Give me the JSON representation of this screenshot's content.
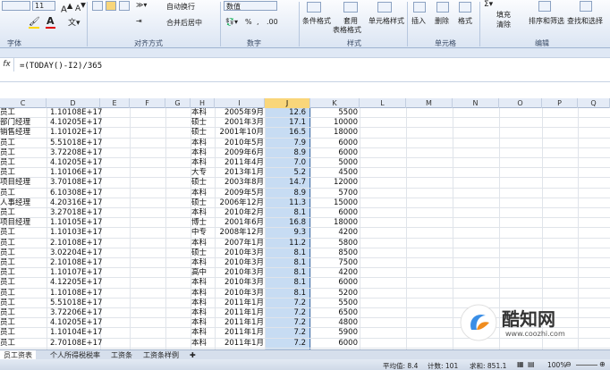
{
  "ribbon": {
    "font_size": "11",
    "wrap_text": "自动换行",
    "merge_center": "合并后居中",
    "number_format": "数值",
    "conditional_format": "条件格式",
    "table_format_1": "套用",
    "table_format_2": "表格格式",
    "cell_style": "单元格样式",
    "insert": "插入",
    "delete": "删除",
    "format": "格式",
    "fill": "填充",
    "clear": "清除",
    "sort_filter": "排序和筛选",
    "find_select": "查找和选择",
    "groups": [
      "字体",
      "对齐方式",
      "数字",
      "样式",
      "单元格",
      "编辑"
    ]
  },
  "formula_bar": {
    "fx": "fx",
    "formula": "=(TODAY()-I2)/365"
  },
  "columns": [
    "C",
    "D",
    "E",
    "F",
    "G",
    "H",
    "I",
    "J",
    "K",
    "L",
    "M",
    "N",
    "O",
    "P",
    "Q"
  ],
  "rows": [
    [
      "员工",
      "1.10108E+17",
      "本科",
      "2005年9月",
      "12.6",
      "5500"
    ],
    [
      "部门经理",
      "4.10205E+17",
      "硕士",
      "2001年3月",
      "17.1",
      "10000"
    ],
    [
      "销售经理",
      "1.10102E+17",
      "硕士",
      "2001年10月",
      "16.5",
      "18000"
    ],
    [
      "员工",
      "5.51018E+17",
      "本科",
      "2010年5月",
      "7.9",
      "6000"
    ],
    [
      "员工",
      "3.72208E+17",
      "本科",
      "2009年6月",
      "8.9",
      "6000"
    ],
    [
      "员工",
      "4.10205E+17",
      "本科",
      "2011年4月",
      "7.0",
      "5000"
    ],
    [
      "员工",
      "1.10106E+17",
      "大专",
      "2013年1月",
      "5.2",
      "4500"
    ],
    [
      "项目经理",
      "3.70108E+17",
      "硕士",
      "2003年8月",
      "14.7",
      "12000"
    ],
    [
      "员工",
      "6.10308E+17",
      "本科",
      "2009年5月",
      "8.9",
      "5700"
    ],
    [
      "人事经理",
      "4.20316E+17",
      "硕士",
      "2006年12月",
      "11.3",
      "15000"
    ],
    [
      "员工",
      "3.27018E+17",
      "本科",
      "2010年2月",
      "8.1",
      "6000"
    ],
    [
      "项目经理",
      "1.10105E+17",
      "博士",
      "2001年6月",
      "16.8",
      "18000"
    ],
    [
      "员工",
      "1.10103E+17",
      "中专",
      "2008年12月",
      "9.3",
      "4200"
    ],
    [
      "员工",
      "2.10108E+17",
      "本科",
      "2007年1月",
      "11.2",
      "5800"
    ],
    [
      "员工",
      "3.02204E+17",
      "硕士",
      "2010年3月",
      "8.1",
      "8500"
    ],
    [
      "员工",
      "2.10108E+17",
      "本科",
      "2010年3月",
      "8.1",
      "7500"
    ],
    [
      "员工",
      "1.10107E+17",
      "高中",
      "2010年3月",
      "8.1",
      "4200"
    ],
    [
      "员工",
      "4.12205E+17",
      "本科",
      "2010年3月",
      "8.1",
      "6000"
    ],
    [
      "员工",
      "1.10108E+17",
      "本科",
      "2010年3月",
      "8.1",
      "5200"
    ],
    [
      "员工",
      "5.51018E+17",
      "本科",
      "2011年1月",
      "7.2",
      "5500"
    ],
    [
      "员工",
      "3.72206E+17",
      "本科",
      "2011年1月",
      "7.2",
      "6500"
    ],
    [
      "员工",
      "4.10205E+17",
      "本科",
      "2011年1月",
      "7.2",
      "4800"
    ],
    [
      "员工",
      "1.10104E+17",
      "本科",
      "2011年1月",
      "7.2",
      "5900"
    ],
    [
      "员工",
      "2.70108E+17",
      "本科",
      "2011年1月",
      "7.2",
      "6000"
    ]
  ],
  "sheet_tabs": [
    "员工资表",
    "个人所得税税率",
    "工资条",
    "工资条样例"
  ],
  "status": {
    "average": "平均值: 8.4",
    "count": "计数: 101",
    "sum": "求和: 851.1",
    "zoom": "100%"
  },
  "watermark": {
    "brand": "酷知网",
    "url": "www.coozhi.com"
  }
}
